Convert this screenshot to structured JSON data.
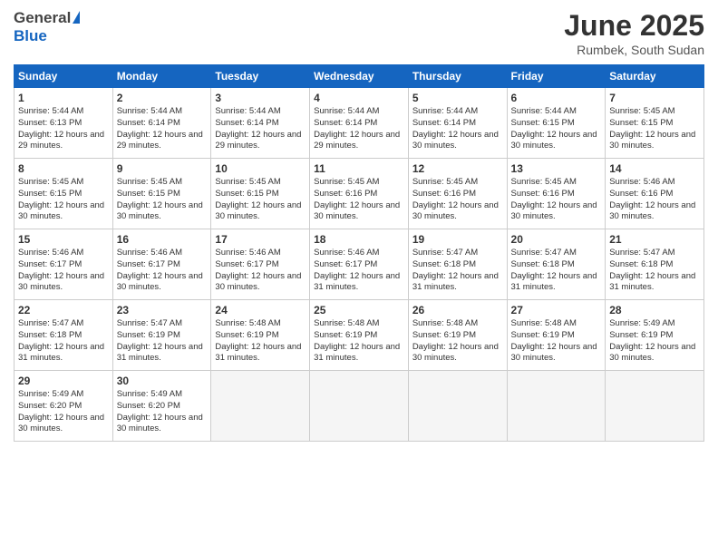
{
  "header": {
    "logo_general": "General",
    "logo_blue": "Blue",
    "month_title": "June 2025",
    "location": "Rumbek, South Sudan"
  },
  "weekdays": [
    "Sunday",
    "Monday",
    "Tuesday",
    "Wednesday",
    "Thursday",
    "Friday",
    "Saturday"
  ],
  "weeks": [
    [
      {
        "day": "1",
        "sunrise": "Sunrise: 5:44 AM",
        "sunset": "Sunset: 6:13 PM",
        "daylight": "Daylight: 12 hours and 29 minutes."
      },
      {
        "day": "2",
        "sunrise": "Sunrise: 5:44 AM",
        "sunset": "Sunset: 6:14 PM",
        "daylight": "Daylight: 12 hours and 29 minutes."
      },
      {
        "day": "3",
        "sunrise": "Sunrise: 5:44 AM",
        "sunset": "Sunset: 6:14 PM",
        "daylight": "Daylight: 12 hours and 29 minutes."
      },
      {
        "day": "4",
        "sunrise": "Sunrise: 5:44 AM",
        "sunset": "Sunset: 6:14 PM",
        "daylight": "Daylight: 12 hours and 29 minutes."
      },
      {
        "day": "5",
        "sunrise": "Sunrise: 5:44 AM",
        "sunset": "Sunset: 6:14 PM",
        "daylight": "Daylight: 12 hours and 30 minutes."
      },
      {
        "day": "6",
        "sunrise": "Sunrise: 5:44 AM",
        "sunset": "Sunset: 6:15 PM",
        "daylight": "Daylight: 12 hours and 30 minutes."
      },
      {
        "day": "7",
        "sunrise": "Sunrise: 5:45 AM",
        "sunset": "Sunset: 6:15 PM",
        "daylight": "Daylight: 12 hours and 30 minutes."
      }
    ],
    [
      {
        "day": "8",
        "sunrise": "Sunrise: 5:45 AM",
        "sunset": "Sunset: 6:15 PM",
        "daylight": "Daylight: 12 hours and 30 minutes."
      },
      {
        "day": "9",
        "sunrise": "Sunrise: 5:45 AM",
        "sunset": "Sunset: 6:15 PM",
        "daylight": "Daylight: 12 hours and 30 minutes."
      },
      {
        "day": "10",
        "sunrise": "Sunrise: 5:45 AM",
        "sunset": "Sunset: 6:15 PM",
        "daylight": "Daylight: 12 hours and 30 minutes."
      },
      {
        "day": "11",
        "sunrise": "Sunrise: 5:45 AM",
        "sunset": "Sunset: 6:16 PM",
        "daylight": "Daylight: 12 hours and 30 minutes."
      },
      {
        "day": "12",
        "sunrise": "Sunrise: 5:45 AM",
        "sunset": "Sunset: 6:16 PM",
        "daylight": "Daylight: 12 hours and 30 minutes."
      },
      {
        "day": "13",
        "sunrise": "Sunrise: 5:45 AM",
        "sunset": "Sunset: 6:16 PM",
        "daylight": "Daylight: 12 hours and 30 minutes."
      },
      {
        "day": "14",
        "sunrise": "Sunrise: 5:46 AM",
        "sunset": "Sunset: 6:16 PM",
        "daylight": "Daylight: 12 hours and 30 minutes."
      }
    ],
    [
      {
        "day": "15",
        "sunrise": "Sunrise: 5:46 AM",
        "sunset": "Sunset: 6:17 PM",
        "daylight": "Daylight: 12 hours and 30 minutes."
      },
      {
        "day": "16",
        "sunrise": "Sunrise: 5:46 AM",
        "sunset": "Sunset: 6:17 PM",
        "daylight": "Daylight: 12 hours and 30 minutes."
      },
      {
        "day": "17",
        "sunrise": "Sunrise: 5:46 AM",
        "sunset": "Sunset: 6:17 PM",
        "daylight": "Daylight: 12 hours and 30 minutes."
      },
      {
        "day": "18",
        "sunrise": "Sunrise: 5:46 AM",
        "sunset": "Sunset: 6:17 PM",
        "daylight": "Daylight: 12 hours and 31 minutes."
      },
      {
        "day": "19",
        "sunrise": "Sunrise: 5:47 AM",
        "sunset": "Sunset: 6:18 PM",
        "daylight": "Daylight: 12 hours and 31 minutes."
      },
      {
        "day": "20",
        "sunrise": "Sunrise: 5:47 AM",
        "sunset": "Sunset: 6:18 PM",
        "daylight": "Daylight: 12 hours and 31 minutes."
      },
      {
        "day": "21",
        "sunrise": "Sunrise: 5:47 AM",
        "sunset": "Sunset: 6:18 PM",
        "daylight": "Daylight: 12 hours and 31 minutes."
      }
    ],
    [
      {
        "day": "22",
        "sunrise": "Sunrise: 5:47 AM",
        "sunset": "Sunset: 6:18 PM",
        "daylight": "Daylight: 12 hours and 31 minutes."
      },
      {
        "day": "23",
        "sunrise": "Sunrise: 5:47 AM",
        "sunset": "Sunset: 6:19 PM",
        "daylight": "Daylight: 12 hours and 31 minutes."
      },
      {
        "day": "24",
        "sunrise": "Sunrise: 5:48 AM",
        "sunset": "Sunset: 6:19 PM",
        "daylight": "Daylight: 12 hours and 31 minutes."
      },
      {
        "day": "25",
        "sunrise": "Sunrise: 5:48 AM",
        "sunset": "Sunset: 6:19 PM",
        "daylight": "Daylight: 12 hours and 31 minutes."
      },
      {
        "day": "26",
        "sunrise": "Sunrise: 5:48 AM",
        "sunset": "Sunset: 6:19 PM",
        "daylight": "Daylight: 12 hours and 30 minutes."
      },
      {
        "day": "27",
        "sunrise": "Sunrise: 5:48 AM",
        "sunset": "Sunset: 6:19 PM",
        "daylight": "Daylight: 12 hours and 30 minutes."
      },
      {
        "day": "28",
        "sunrise": "Sunrise: 5:49 AM",
        "sunset": "Sunset: 6:19 PM",
        "daylight": "Daylight: 12 hours and 30 minutes."
      }
    ],
    [
      {
        "day": "29",
        "sunrise": "Sunrise: 5:49 AM",
        "sunset": "Sunset: 6:20 PM",
        "daylight": "Daylight: 12 hours and 30 minutes."
      },
      {
        "day": "30",
        "sunrise": "Sunrise: 5:49 AM",
        "sunset": "Sunset: 6:20 PM",
        "daylight": "Daylight: 12 hours and 30 minutes."
      },
      {
        "day": "",
        "sunrise": "",
        "sunset": "",
        "daylight": ""
      },
      {
        "day": "",
        "sunrise": "",
        "sunset": "",
        "daylight": ""
      },
      {
        "day": "",
        "sunrise": "",
        "sunset": "",
        "daylight": ""
      },
      {
        "day": "",
        "sunrise": "",
        "sunset": "",
        "daylight": ""
      },
      {
        "day": "",
        "sunrise": "",
        "sunset": "",
        "daylight": ""
      }
    ]
  ]
}
